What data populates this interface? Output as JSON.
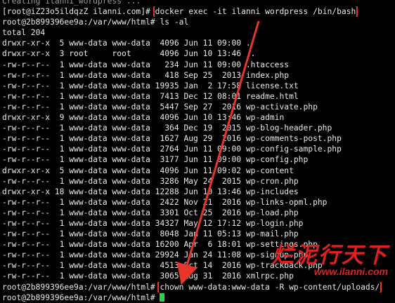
{
  "terminal": {
    "lines": [
      {
        "text": "Creating ilanni_wordpress ...",
        "dim": true
      },
      {
        "prompt": "[root@iZ23o5ildqzZ ilanni.com]# ",
        "cmd": "docker exec -it ilanni wordpress /bin/bash",
        "highlight": true
      },
      {
        "text": "root@2b899396ee9a:/var/www/html# ls -al"
      },
      {
        "text": "total 204"
      },
      {
        "text": "drwxr-xr-x  5 www-data www-data  4096 Jun 11 09:00 ."
      },
      {
        "text": "drwxr-xr-x  3 root     root      4096 Jun 10 13:46 .."
      },
      {
        "text": "-rw-r--r--  1 www-data www-data   234 Jun 11 09:00 .htaccess"
      },
      {
        "text": "-rw-r--r--  1 www-data www-data   418 Sep 25  2013 index.php"
      },
      {
        "text": "-rw-r--r--  1 www-data www-data 19935 Jan  2 17:58 license.txt"
      },
      {
        "text": "-rw-r--r--  1 www-data www-data  7413 Dec 12 08:01 readme.html"
      },
      {
        "text": "-rw-r--r--  1 www-data www-data  5447 Sep 27  2016 wp-activate.php"
      },
      {
        "text": "drwxr-xr-x  9 www-data www-data  4096 Jun 10 13:46 wp-admin"
      },
      {
        "text": "-rw-r--r--  1 www-data www-data   364 Dec 19  2015 wp-blog-header.php"
      },
      {
        "text": "-rw-r--r--  1 www-data www-data  1627 Aug 29  2016 wp-comments-post.php"
      },
      {
        "text": "-rw-r--r--  1 www-data www-data  2764 Jun 11 09:00 wp-config-sample.php"
      },
      {
        "text": "-rw-r--r--  1 www-data www-data  3177 Jun 11 09:00 wp-config.php"
      },
      {
        "text": "drwxr-xr-x  5 www-data www-data  4096 Jun 11 09:02 wp-content"
      },
      {
        "text": "-rw-r--r--  1 www-data www-data  3286 May 24  2015 wp-cron.php"
      },
      {
        "text": "drwxr-xr-x 18 www-data www-data 12288 Jun 10 13:46 wp-includes"
      },
      {
        "text": "-rw-r--r--  1 www-data www-data  2422 Nov 21  2016 wp-links-opml.php"
      },
      {
        "text": "-rw-r--r--  1 www-data www-data  3301 Oct 25  2016 wp-load.php"
      },
      {
        "text": "-rw-r--r--  1 www-data www-data 34327 May 12 17:12 wp-login.php"
      },
      {
        "text": "-rw-r--r--  1 www-data www-data  8048 Jan 11 05:13 wp-mail.php"
      },
      {
        "text": "-rw-r--r--  1 www-data www-data 16200 Apr  6 18:01 wp-settings.php"
      },
      {
        "text": "-rw-r--r--  1 www-data www-data 29924 Jan 24 11:08 wp-signup.php"
      },
      {
        "text": "-rw-r--r--  1 www-data www-data  4513 Oct 14  2016 wp-trackback.php"
      },
      {
        "text": "-rw-r--r--  1 www-data www-data  3065 Aug 31  2016 xmlrpc.php"
      },
      {
        "prompt": "root@2b899396ee9a:/var/www/html# ",
        "cmd": "chown www-data:www-data -R wp-content/uploads/",
        "highlight": true
      },
      {
        "prompt": "root@2b899396ee9a:/var/www/html# ",
        "cmd": "",
        "cursor": true
      }
    ]
  },
  "watermark": {
    "chinese": "烂泥行天下",
    "url": "www.ilanni.com"
  },
  "colors": {
    "background": "#000000",
    "text": "#e8e8e8",
    "highlight_box": "#e8342a",
    "arrow": "#e8342a",
    "cursor": "#2ad04a",
    "watermark": "#e02020"
  }
}
